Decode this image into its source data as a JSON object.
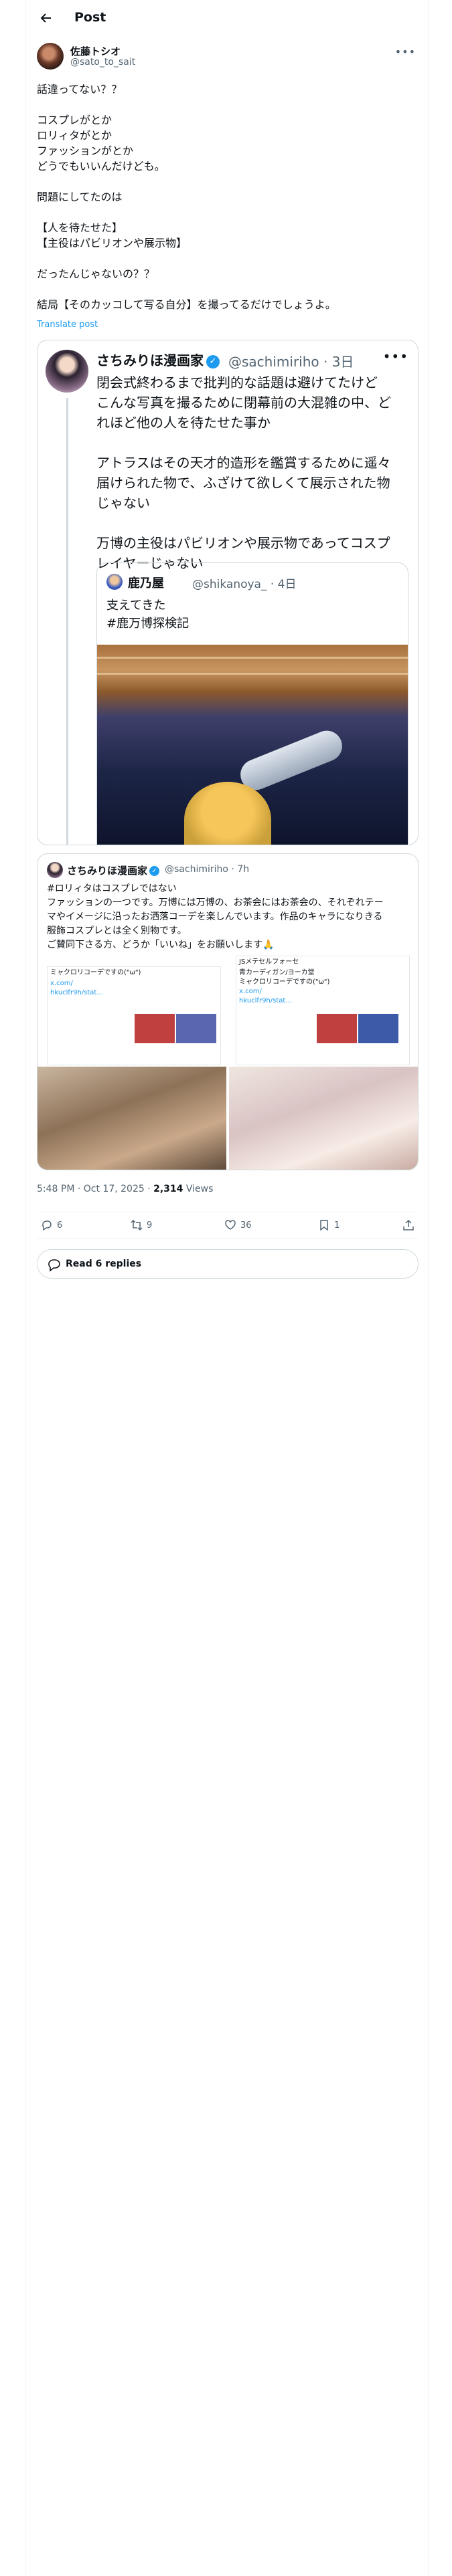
{
  "header": {
    "title": "Post"
  },
  "post": {
    "author": {
      "name": "佐藤トシオ",
      "handle": "@sato_to_sait"
    },
    "text": "話違ってない？？\n\nコスプレがとか\nロリィタがとか\nファッションがとか\nどうでもいいんだけども。\n\n問題にしてたのは\n\n【人を待たせた】\n【主役はパビリオンや展示物】\n\nだったんじゃないの？？\n\n結局【そのカッコして写る自分】を撮ってるだけでしょうよ。",
    "translate": "Translate post",
    "timestamp": "5:48 PM · Oct 17, 2025 · ",
    "views_count": "2,314",
    "views_label": " Views"
  },
  "quote1": {
    "name": "さちみりほ漫画家",
    "handle": "@sachimiriho · 3日",
    "text": "閉会式終わるまで批判的な話題は避けてたけど\nこんな写真を撮るために閉幕前の大混雑の中、ど\nれほど他の人を待たせた事か\n\nアトラスはその天才的造形を鑑賞するために遥々\n届けられた物で、ふざけて欲しくて展示された物\nじゃない\n\n万博の主役はパビリオンや展示物であってコスプ\nレイヤーじゃない",
    "inner": {
      "name": "鹿乃屋",
      "handle": "@shikanoya_ · 4日",
      "text": "支えてきた\n#鹿万博探検記"
    }
  },
  "quote2": {
    "name": "さちみりほ漫画家",
    "handle": "@sachimiriho · 7h",
    "text": "#ロリィタはコスプレではない\nファッションの一つです。万博には万博の、お茶会にはお茶会の、それぞれテー\nマやイメージに沿ったお洒落コーデを楽しんでいます。作品のキャラになりきる\n服飾コスプレとは全く別物です。\nご賛同下さる方、どうか「いいね」をお願いします🙏",
    "shot_left": {
      "line1": "ミャクロリコーデですの(\"ω\")",
      "link": "x.com/",
      "link2": "hkuclfr9h/stat..."
    },
    "shot_right": {
      "line1": "JSメテセルフォーセ",
      "line2": "青カーディガン/ヨーカ堂",
      "line3": "ミャクロリコーデですの(\"ω\")",
      "link": "x.com/",
      "link2": "hkuclfr9h/stat..."
    }
  },
  "actions": {
    "replies": "6",
    "reposts": "9",
    "likes": "36",
    "bookmarks": "1"
  },
  "read_replies": "Read 6 replies"
}
